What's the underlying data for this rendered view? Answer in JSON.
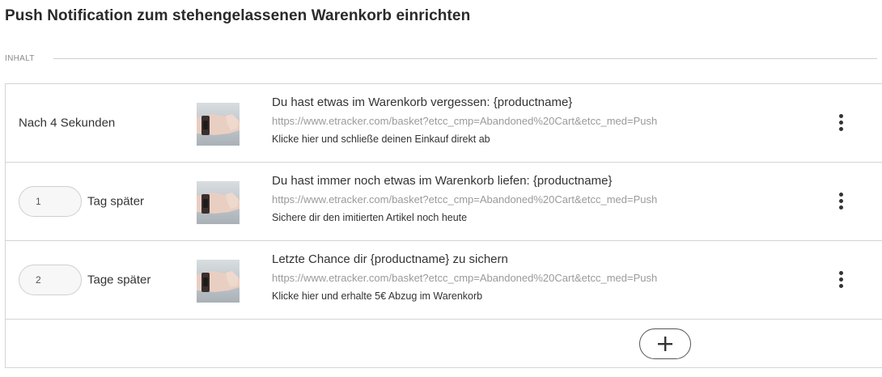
{
  "page": {
    "title": "Push Notification zum stehengelassenen Warenkorb einrichten",
    "section_label": "INHALT"
  },
  "rows": [
    {
      "delay_label": "Nach 4 Sekunden",
      "title": "Du hast etwas im Warenkorb vergessen: {productname}",
      "url": "https://www.etracker.com/basket?etcc_cmp=Abandoned%20Cart&etcc_med=Push",
      "body": "Klicke hier und schließe deinen Einkauf direkt ab"
    },
    {
      "delay_value": "1",
      "delay_unit": "Tag später",
      "title": "Du hast immer noch etwas im Warenkorb liefen: {productname}",
      "url": "https://www.etracker.com/basket?etcc_cmp=Abandoned%20Cart&etcc_med=Push",
      "body": "Sichere dir den imitierten Artikel noch heute"
    },
    {
      "delay_value": "2",
      "delay_unit": "Tage später",
      "title": "Letzte Chance dir {productname} zu sichern",
      "url": "https://www.etracker.com/basket?etcc_cmp=Abandoned%20Cart&etcc_med=Push",
      "body": "Klicke hier und erhalte 5€ Abzug im Warenkorb"
    }
  ],
  "icons": {
    "row_menu": "more-vertical-icon",
    "add": "plus-icon",
    "thumbnail": "wrist-watch-image"
  },
  "colors": {
    "border": "#d4d4d4",
    "url_text": "#9a9a9a",
    "input_bg": "#f7f7f7"
  }
}
